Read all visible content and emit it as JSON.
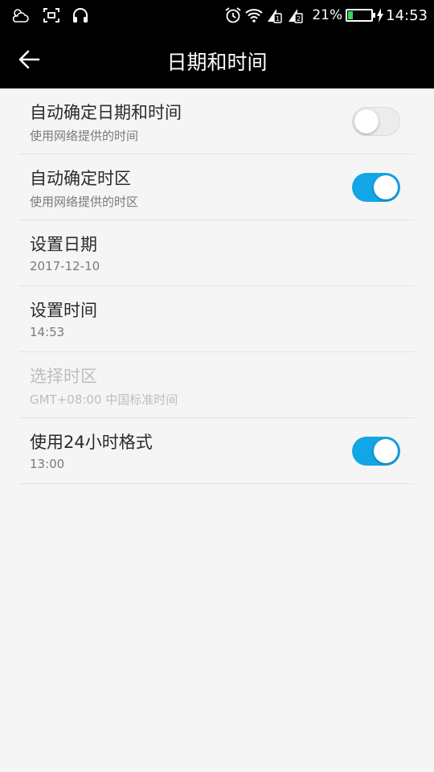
{
  "status_bar": {
    "battery_percent_text": "21%",
    "battery_level": 0.21,
    "time": "14:53",
    "icons": [
      "weather-cloud-icon",
      "screenshot-icon",
      "headphones-icon",
      "alarm-icon",
      "wifi-icon",
      "sim1-signal-icon",
      "sim2-signal-icon",
      "battery-icon",
      "charging-icon"
    ]
  },
  "header": {
    "title": "日期和时间",
    "back_icon": "back-arrow-icon"
  },
  "settings": {
    "items": [
      {
        "title": "自动确定日期和时间",
        "subtitle": "使用网络提供的时间",
        "toggle": "off"
      },
      {
        "title": "自动确定时区",
        "subtitle": "使用网络提供的时区",
        "toggle": "on"
      },
      {
        "title": "设置日期",
        "subtitle": "2017-12-10"
      },
      {
        "title": "设置时间",
        "subtitle": "14:53"
      },
      {
        "title": "选择时区",
        "subtitle": "GMT+08:00 中国标准时间",
        "disabled": true
      },
      {
        "title": "使用24小时格式",
        "subtitle": "13:00",
        "toggle": "on"
      }
    ]
  },
  "colors": {
    "accent": "#12a6e6",
    "header_bg": "#000000",
    "page_bg": "#f5f5f5",
    "battery_fill": "#37d35f"
  }
}
